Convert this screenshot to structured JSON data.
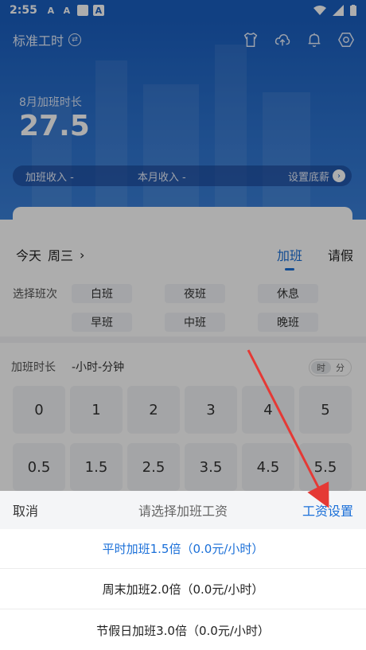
{
  "status_bar": {
    "time": "2:55",
    "icon_a1": "A",
    "icon_a2": "A",
    "icon_a3": "A"
  },
  "header": {
    "title": "标准工时",
    "icons": [
      "shirt-icon",
      "cloud-upload-icon",
      "bell-icon",
      "settings-icon"
    ]
  },
  "overtime": {
    "label": "8月加班时长",
    "value": "27.5"
  },
  "salary_bar": {
    "overtime_income": "加班收入 -",
    "monthly_income": "本月收入 -",
    "set_base": "设置底薪"
  },
  "panel": {
    "today": "今天",
    "weekday": "周三",
    "chevron": "›",
    "tabs": [
      "加班",
      "请假"
    ],
    "shift_label": "选择班次",
    "shifts": [
      "白班",
      "夜班",
      "休息",
      "早班",
      "中班",
      "晚班"
    ],
    "duration_label": "加班时长",
    "duration_value": "-小时-分钟",
    "toggle": [
      "时",
      "分"
    ],
    "keys_row1": [
      "0",
      "1",
      "2",
      "3",
      "4",
      "5"
    ],
    "keys_row2": [
      "0.5",
      "1.5",
      "2.5",
      "3.5",
      "4.5",
      "5.5"
    ]
  },
  "sheet": {
    "cancel": "取消",
    "title": "请选择加班工资",
    "settings": "工资设置",
    "options": [
      {
        "label": "平时加班1.5倍（0.0元/小时）",
        "selected": true
      },
      {
        "label": "周末加班2.0倍（0.0元/小时）",
        "selected": false
      },
      {
        "label": "节假日加班3.0倍（0.0元/小时）",
        "selected": false
      }
    ]
  },
  "colors": {
    "primary": "#1a6fd8",
    "hero": "#1a5fc0",
    "annotation_arrow": "#e53935"
  }
}
